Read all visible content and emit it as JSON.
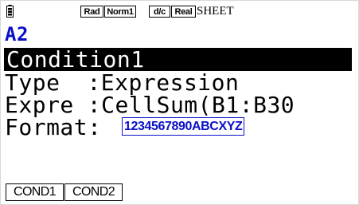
{
  "status_bar": {
    "angle_mode": "Rad",
    "display_mode": "Norm1",
    "fraction_mode": "d/c",
    "complex_mode": "Real",
    "app_name": "SHEET"
  },
  "cell": {
    "reference": "A2"
  },
  "condition": {
    "title": "Condition1",
    "type_label": "Type",
    "type_separator": ":",
    "type_value": "Expression",
    "expr_label": "Expre",
    "expr_separator": ":",
    "expr_value": "CellSum(B1:B30",
    "format_label": "Format",
    "format_separator": ":",
    "format_sample": "1234567890ABCXYZ"
  },
  "function_keys": [
    {
      "label": "COND1"
    },
    {
      "label": "COND2"
    }
  ],
  "colors": {
    "cell_reference": "#0a10c8",
    "format_sample": "#0a10c8",
    "highlight_bar": "#000000"
  }
}
